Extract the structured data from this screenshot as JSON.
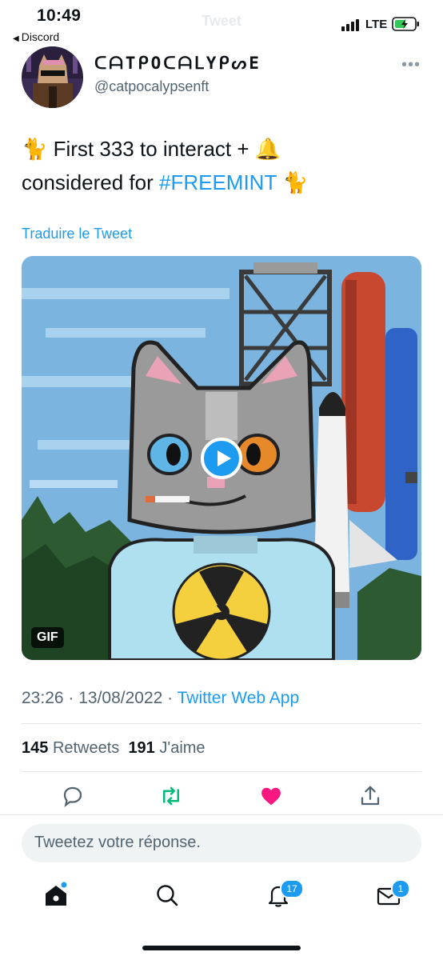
{
  "status_bar": {
    "time": "10:49",
    "back_label": "Discord",
    "network": "LTE",
    "ghost_title": "Tweet"
  },
  "tweet": {
    "display_name": "ᑕᗩTᑭOᑕᗩᒪYᑭᔕE",
    "handle": "@catpocalypsenft",
    "text_part1": "🐈 First 333 to interact + 🔔",
    "text_part2": "considered for ",
    "hashtag": "#FREEMINT",
    "text_part3": " 🐈",
    "translate_label": "Traduire le Tweet",
    "media_badge": "GIF",
    "timestamp": "23:26 · 13/08/2022 · ",
    "source": "Twitter Web App",
    "retweets_count": "145",
    "retweets_label": "Retweets",
    "likes_count": "191",
    "likes_label": "J'aime"
  },
  "reply_box": {
    "placeholder": "Tweetez votre réponse."
  },
  "tab_bar": {
    "notifications_badge": "17",
    "messages_badge": "1"
  },
  "colors": {
    "accent": "#1d9bf0",
    "like": "#f91880",
    "retweet": "#00ba7c"
  },
  "icons": [
    "signal-icon",
    "battery-charging-icon",
    "more-icon",
    "play-icon",
    "reply-icon",
    "retweet-icon",
    "like-icon",
    "share-icon",
    "home-icon",
    "search-icon",
    "notifications-icon",
    "messages-icon"
  ]
}
